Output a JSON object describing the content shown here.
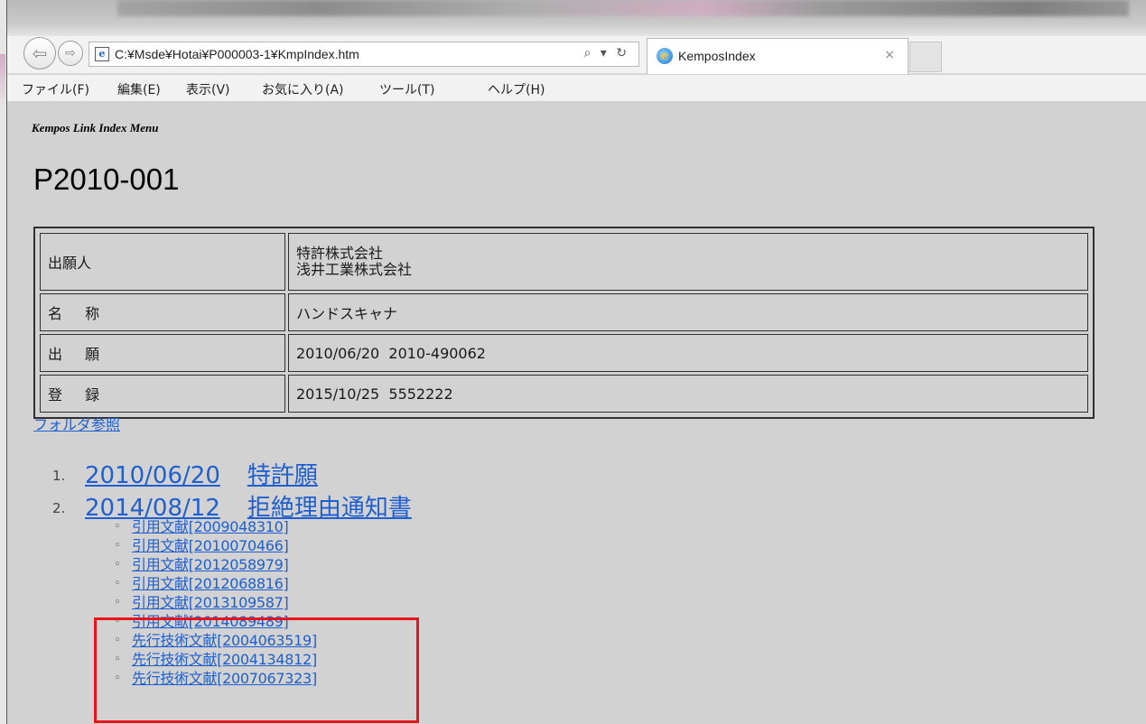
{
  "browser": {
    "address_url": "C:¥Msde¥Hotai¥P000003-1¥KmpIndex.htm",
    "address_tools": "⌕ ▾ ↻",
    "tab_title": "KemposIndex",
    "tab_close": "×",
    "back_glyph": "⇦",
    "forward_glyph": "⇨",
    "page_icon_glyph": "e",
    "menu": [
      "ファイル(F)",
      "編集(E)",
      "表示(V)",
      "お気に入り(A)",
      "ツール(T)",
      "ヘルプ(H)"
    ]
  },
  "page": {
    "subtitle": "Kempos Link Index Menu",
    "case_number": "P2010-001",
    "info": {
      "applicant_label": "出願人",
      "applicant_values": [
        "特許株式会社",
        "浅井工業株式会社"
      ],
      "name_label": "名 称",
      "name_value": "ハンドスキャナ",
      "filing_label": "出 願",
      "filing_value": "2010/06/20  2010-490062",
      "registration_label": "登 録",
      "registration_value": "2015/10/25  5552222"
    },
    "folder_link": "フォルダ参照",
    "documents": [
      {
        "num": "1.",
        "date": "2010/06/20",
        "title": "特許願"
      },
      {
        "num": "2.",
        "date": "2014/08/12",
        "title": "拒絶理由通知書"
      }
    ],
    "bullet": "◦",
    "citations": [
      "引用文献[2009048310]",
      "引用文献[2010070466]",
      "引用文献[2012058979]",
      "引用文献[2012068816]",
      "引用文献[2013109587]",
      "引用文献[2014089489]",
      "先行技術文献[2004063519]",
      "先行技術文献[2004134812]",
      "先行技術文献[2007067323]"
    ]
  },
  "colors": {
    "link": "#1f5fcf",
    "highlight": "#e8141c",
    "page_bg": "#d2d2d2"
  }
}
